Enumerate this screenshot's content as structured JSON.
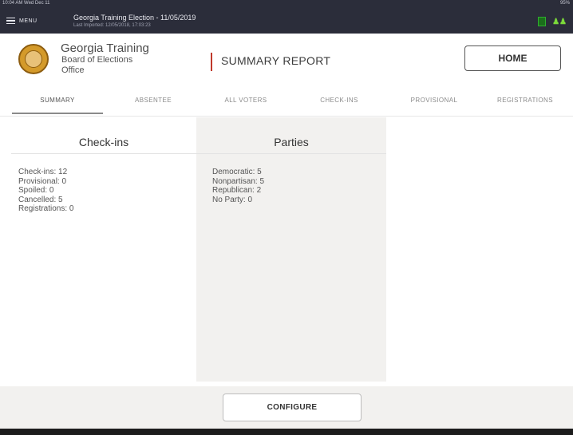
{
  "status_bar": {
    "left": "10:04 AM  Wed Dec 11",
    "right": "95%"
  },
  "top_bar": {
    "menu_label": "MENU",
    "election_title": "Georgia Training Election - 11/05/2019",
    "last_imported": "Last Imported: 12/05/2018, 17:03:23",
    "icons": [
      "document-icon",
      "people-icon"
    ],
    "icon_color": "#7bd93a"
  },
  "header": {
    "org_line1": "Georgia Training",
    "org_line2": "Board of Elections",
    "org_line3": "Office",
    "report_title": "SUMMARY REPORT",
    "home_label": "HOME",
    "accent_color": "#c0392b"
  },
  "tabs": [
    {
      "label": "SUMMARY",
      "active": true
    },
    {
      "label": "ABSENTEE",
      "active": false
    },
    {
      "label": "ALL VOTERS",
      "active": false
    },
    {
      "label": "CHECK-INS",
      "active": false
    },
    {
      "label": "PROVISIONAL",
      "active": false
    },
    {
      "label": "REGISTRATIONS",
      "active": false
    }
  ],
  "panels": {
    "checkins": {
      "title": "Check-ins",
      "items": [
        "Check-ins: 12",
        "Provisional: 0",
        "Spoiled: 0",
        "Cancelled: 5",
        "Registrations: 0"
      ]
    },
    "parties": {
      "title": "Parties",
      "items": [
        "Democratic: 5",
        "Nonpartisan: 5",
        "Republican: 2",
        "No Party: 0"
      ]
    }
  },
  "footer": {
    "configure_label": "CONFIGURE"
  }
}
